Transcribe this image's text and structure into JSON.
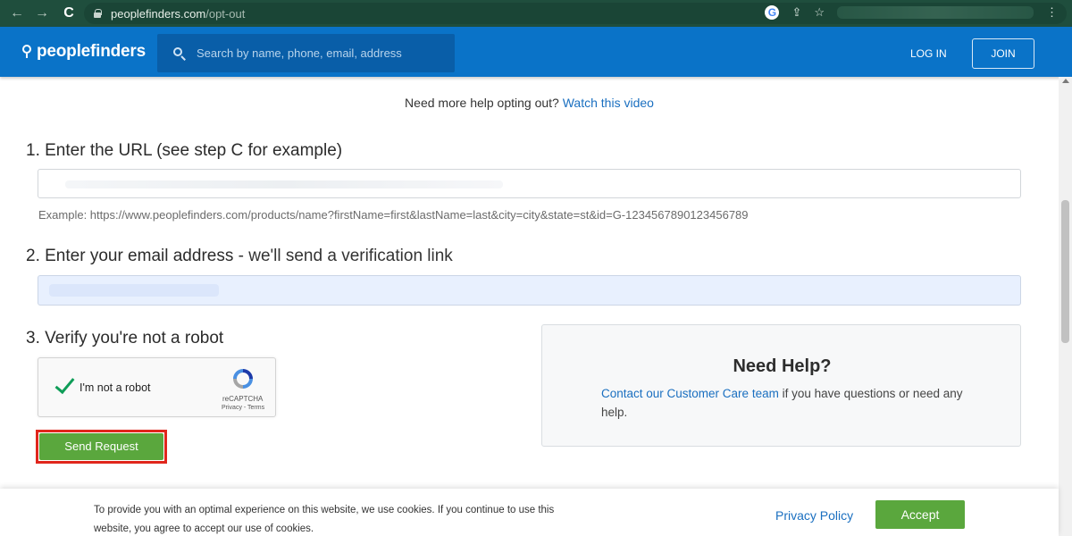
{
  "browser": {
    "url_domain": "peoplefinders.com",
    "url_path": "/opt-out",
    "back_icon": "←",
    "forward_icon": "→",
    "reload_icon": "C",
    "google_icon": "G"
  },
  "header": {
    "logo_text": "peoplefinders",
    "search_placeholder": "Search by name, phone, email, address",
    "login_label": "LOG IN",
    "join_label": "JOIN"
  },
  "help_line": {
    "prefix": "Need more help opting out?",
    "link": "Watch this video"
  },
  "step1": {
    "title": "1. Enter the URL (see step C for example)",
    "example": "Example: https://www.peoplefinders.com/products/name?firstName=first&lastName=last&city=city&state=st&id=G-1234567890123456789"
  },
  "step2": {
    "title": "2. Enter your email address",
    "subtitle": "- we'll send a verification link"
  },
  "step3": {
    "title": "3. Verify you're not a robot"
  },
  "recaptcha": {
    "label": "I'm not a robot",
    "brand": "reCAPTCHA",
    "terms": "Privacy - Terms",
    "checked": true
  },
  "send_button": "Send Request",
  "help_box": {
    "title": "Need Help?",
    "link": "Contact our Customer Care team",
    "text": " if you have questions or need any help."
  },
  "cookie": {
    "text": "To provide you with an optimal experience on this website, we use cookies. If you continue to use this website, you agree to accept our use of cookies.",
    "privacy_label": "Privacy Policy",
    "accept_label": "Accept"
  },
  "colors": {
    "brand_blue": "#0a73c8",
    "button_green": "#5aa73d",
    "highlight_red": "#e0261c",
    "link_blue": "#1a6fc0"
  }
}
